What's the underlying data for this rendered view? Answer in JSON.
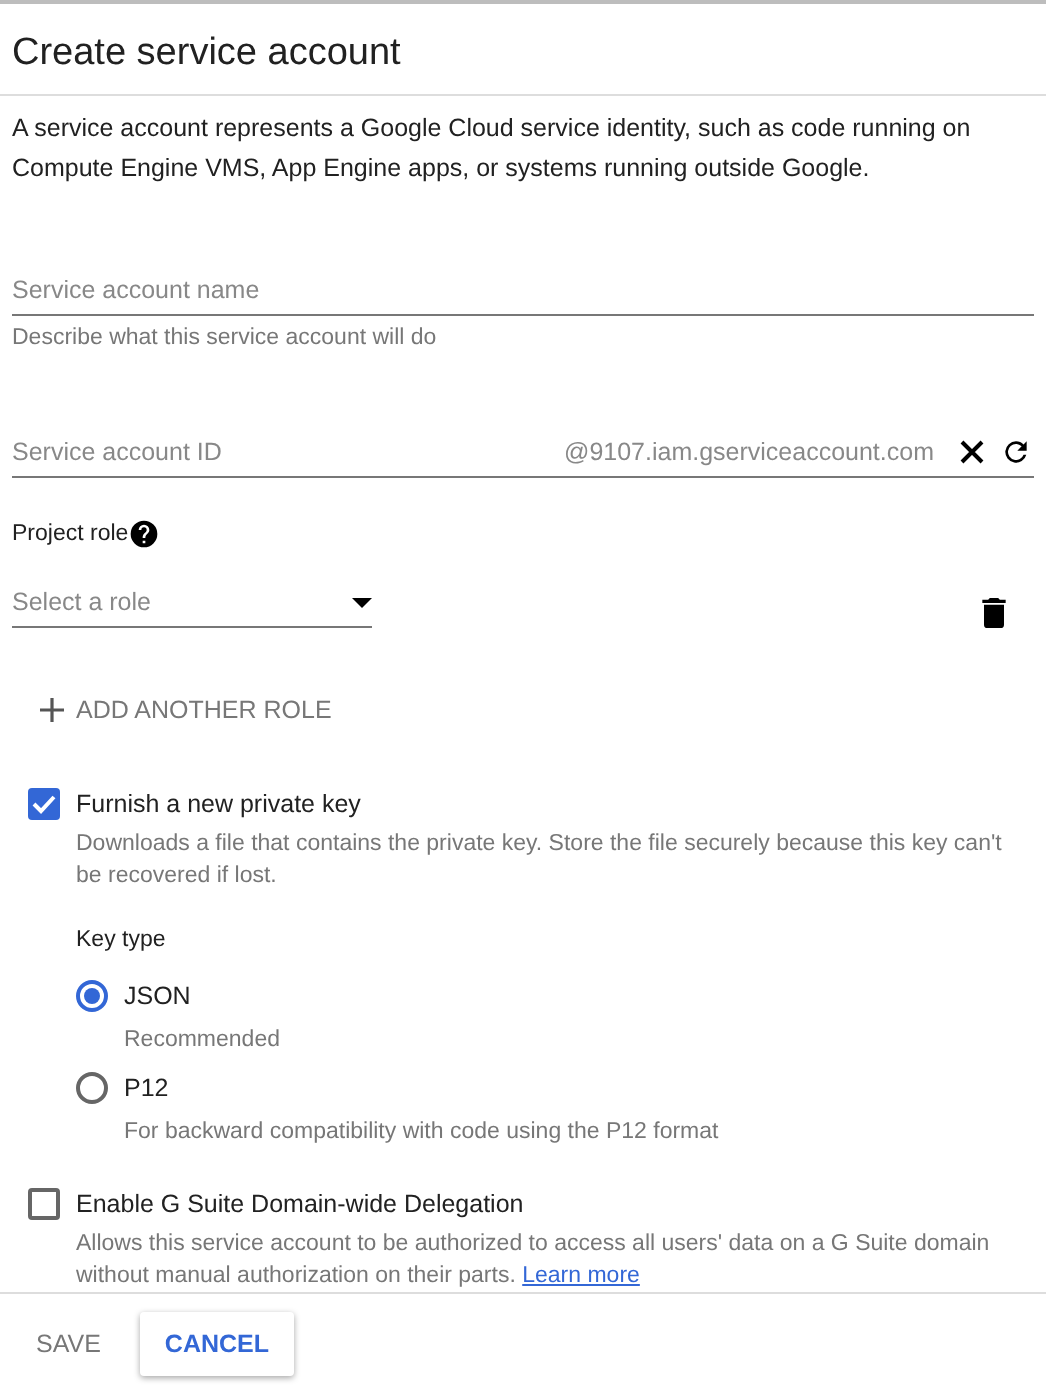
{
  "dialog": {
    "title": "Create service account",
    "description": "A service account represents a Google Cloud service identity, such as code running on Compute Engine VMS, App Engine apps, or systems running outside Google."
  },
  "name_field": {
    "placeholder": "Service account name",
    "helper": "Describe what this service account will do"
  },
  "id_field": {
    "placeholder": "Service account ID",
    "suffix": "@9107.iam.gserviceaccount.com"
  },
  "project_role": {
    "label": "Project role",
    "select_placeholder": "Select a role",
    "add_button": "ADD ANOTHER ROLE"
  },
  "private_key": {
    "label": "Furnish a new private key",
    "checked": true,
    "description": "Downloads a file that contains the private key. Store the file securely because this key can't be recovered if lost.",
    "key_type_label": "Key type",
    "options": [
      {
        "label": "JSON",
        "hint": "Recommended",
        "selected": true
      },
      {
        "label": "P12",
        "hint": "For backward compatibility with code using the P12 format",
        "selected": false
      }
    ]
  },
  "delegation": {
    "label": "Enable G Suite Domain-wide Delegation",
    "checked": false,
    "description": "Allows this service account to be authorized to access all users' data on a G Suite domain without manual authorization on their parts.",
    "link": "Learn more"
  },
  "buttons": [
    {
      "label": "SAVE",
      "kind": "flat",
      "disabled": true
    },
    {
      "label": "CANCEL",
      "kind": "raised",
      "disabled": false
    }
  ]
}
